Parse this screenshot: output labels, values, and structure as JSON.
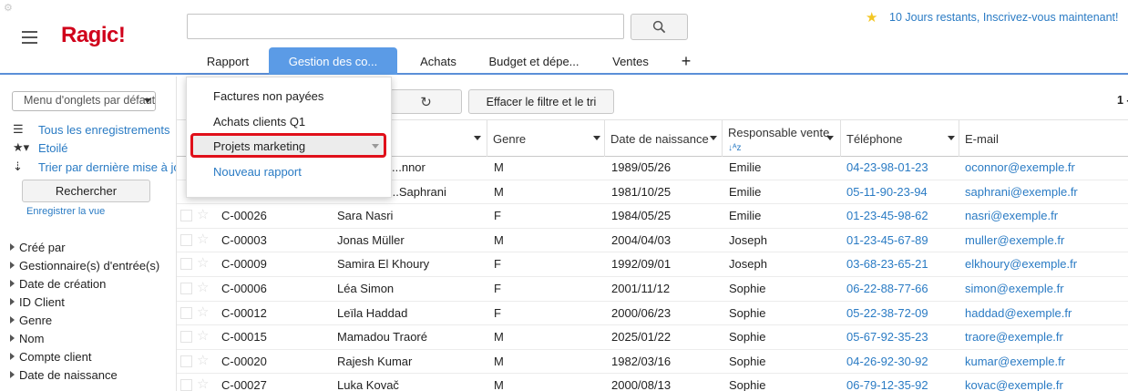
{
  "header": {
    "logo": "Ragic!",
    "search_value": "",
    "promo": "10 Jours restants, Inscrivez-vous maintenant!"
  },
  "tabs": [
    {
      "label": "Rapport",
      "active": false
    },
    {
      "label": "Gestion des co...",
      "active": true
    },
    {
      "label": "Achats",
      "active": false
    },
    {
      "label": "Budget et dépe...",
      "active": false
    },
    {
      "label": "Ventes",
      "active": false
    }
  ],
  "tab_add_label": "+",
  "sidebar": {
    "menu_select": "Menu d'onglets par défaut",
    "links": [
      {
        "label": "Tous les enregistrements",
        "icon": "list-icon"
      },
      {
        "label": "Etoilé",
        "icon": "star-filter-icon"
      },
      {
        "label": "Trier par dernière mise à jour",
        "icon": "sort-icon"
      }
    ],
    "search_button": "Rechercher",
    "save_view": "Enregistrer la vue",
    "filters": [
      "Créé par",
      "Gestionnaire(s) d'entrée(s)",
      "Date de création",
      "ID Client",
      "Genre",
      "Nom",
      "Compte client",
      "Date de naissance"
    ]
  },
  "toolbar": {
    "clear_filter": "Effacer le filtre et le tri",
    "pager": "1 -"
  },
  "grid": {
    "columns": [
      "Genre",
      "Date de naissance",
      "Responsable vente",
      "Téléphone",
      "E-mail"
    ],
    "rows": [
      {
        "id": "",
        "name": "...nnor",
        "genre": "M",
        "dob": "1989/05/26",
        "resp": "Emilie",
        "tel": "04-23-98-01-23",
        "email": "oconnor@exemple.fr"
      },
      {
        "id": "",
        "name": "...Saphrani",
        "genre": "M",
        "dob": "1981/10/25",
        "resp": "Emilie",
        "tel": "05-11-90-23-94",
        "email": "saphrani@exemple.fr"
      },
      {
        "id": "C-00026",
        "name": "Sara Nasri",
        "genre": "F",
        "dob": "1984/05/25",
        "resp": "Emilie",
        "tel": "01-23-45-98-62",
        "email": "nasri@exemple.fr"
      },
      {
        "id": "C-00003",
        "name": "Jonas Müller",
        "genre": "M",
        "dob": "2004/04/03",
        "resp": "Joseph",
        "tel": "01-23-45-67-89",
        "email": "muller@exemple.fr"
      },
      {
        "id": "C-00009",
        "name": "Samira El Khoury",
        "genre": "F",
        "dob": "1992/09/01",
        "resp": "Joseph",
        "tel": "03-68-23-65-21",
        "email": "elkhoury@exemple.fr"
      },
      {
        "id": "C-00006",
        "name": "Léa Simon",
        "genre": "F",
        "dob": "2001/11/12",
        "resp": "Sophie",
        "tel": "06-22-88-77-66",
        "email": "simon@exemple.fr"
      },
      {
        "id": "C-00012",
        "name": "Leïla Haddad",
        "genre": "F",
        "dob": "2000/06/23",
        "resp": "Sophie",
        "tel": "05-22-38-72-09",
        "email": "haddad@exemple.fr"
      },
      {
        "id": "C-00015",
        "name": "Mamadou Traoré",
        "genre": "M",
        "dob": "2025/01/22",
        "resp": "Sophie",
        "tel": "05-67-92-35-23",
        "email": "traore@exemple.fr"
      },
      {
        "id": "C-00020",
        "name": "Rajesh Kumar",
        "genre": "M",
        "dob": "1982/03/16",
        "resp": "Sophie",
        "tel": "04-26-92-30-92",
        "email": "kumar@exemple.fr"
      },
      {
        "id": "C-00027",
        "name": "Luka Kovač",
        "genre": "M",
        "dob": "2000/08/13",
        "resp": "Sophie",
        "tel": "06-79-12-35-92",
        "email": "kovac@exemple.fr"
      }
    ]
  },
  "dropdown": {
    "items": [
      "Factures non payées",
      "Achats clients Q1",
      "Projets marketing"
    ],
    "new_report": "Nouveau rapport",
    "highlighted_index": 2
  },
  "colors": {
    "brand": "#d0021b",
    "tab_active": "#5b9be6",
    "link": "#2a7bc4",
    "highlight_border": "#e0101a"
  }
}
